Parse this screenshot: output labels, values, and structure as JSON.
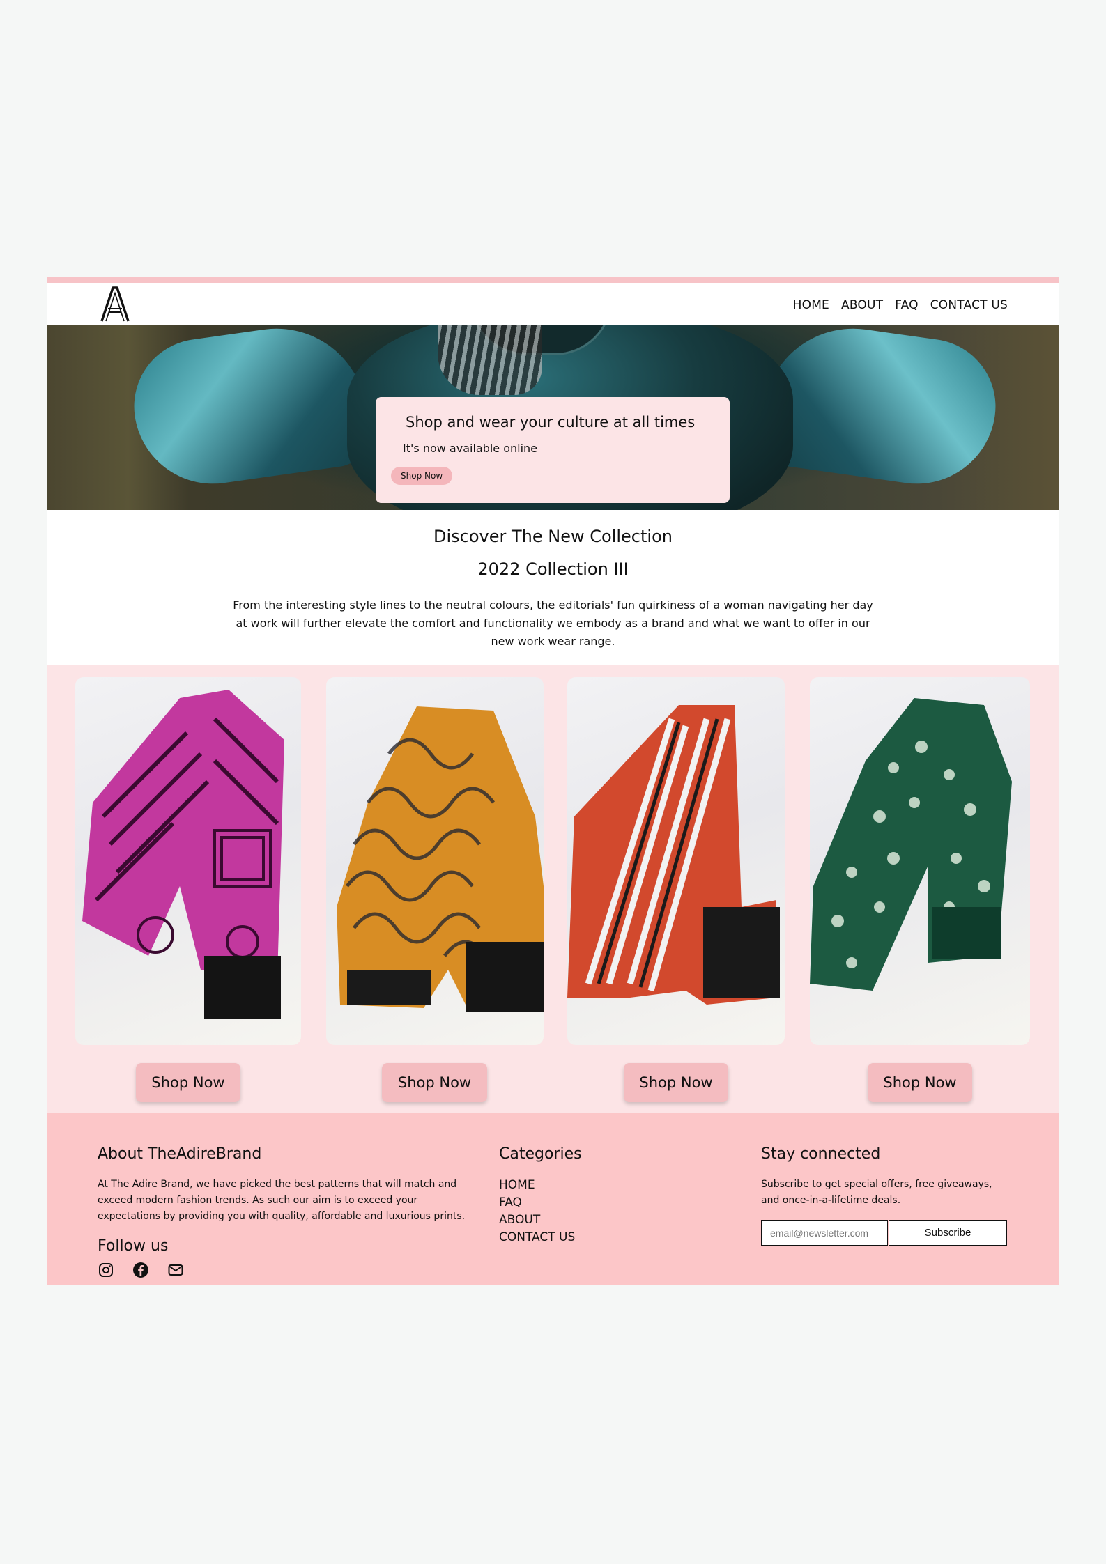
{
  "nav": {
    "links": [
      "HOME",
      "ABOUT",
      "FAQ",
      "CONTACT US"
    ]
  },
  "hero": {
    "title": "Shop and wear your culture at all times",
    "subtitle": "It's now available online",
    "button": "Shop Now"
  },
  "collection": {
    "heading": "Discover The New Collection",
    "subheading": "2022 Collection III",
    "description": "From the interesting style lines to the neutral colours, the editorials' fun quirkiness of a woman navigating her day at work will further elevate the comfort and functionality we embody as a brand and what we want to offer in our new work wear range."
  },
  "products": [
    {
      "button": "Shop Now",
      "pattern": "magenta-geometric",
      "color": "#c2389e"
    },
    {
      "button": "Shop Now",
      "pattern": "orange-floral",
      "color": "#d88d24"
    },
    {
      "button": "Shop Now",
      "pattern": "red-orange-stripes",
      "color": "#d2492d"
    },
    {
      "button": "Shop Now",
      "pattern": "green-batik",
      "color": "#1c5a41"
    }
  ],
  "footer": {
    "about_title": "About TheAdireBrand",
    "about_text": "At The Adire Brand, we have picked the best patterns that will match and exceed modern fashion trends. As such our aim is to exceed your expectations by providing you with quality, affordable and luxurious prints.",
    "follow_title": "Follow us",
    "categories_title": "Categories",
    "categories": [
      "HOME",
      "FAQ",
      "ABOUT",
      "CONTACT US"
    ],
    "stay_title": "Stay connected",
    "stay_text": "Subscribe to get special offers, free giveaways, and once-in-a-lifetime deals.",
    "email_placeholder": "email@newsletter.com",
    "subscribe_label": "Subscribe"
  },
  "colors": {
    "accent_pink": "#f7c3c7",
    "light_pink": "#fce4e6",
    "footer_pink": "#fcc6c8"
  }
}
